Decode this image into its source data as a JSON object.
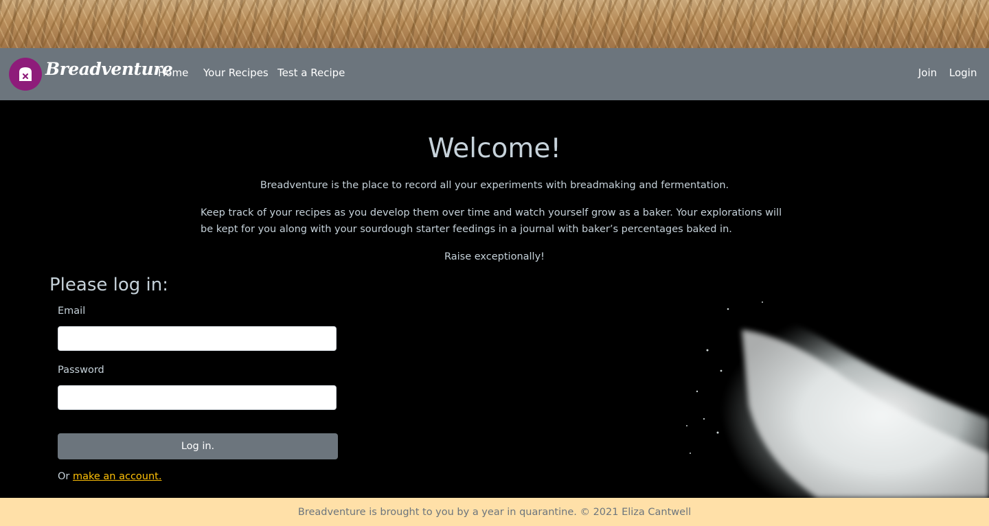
{
  "banner": {
    "image": "wheat-field-banner"
  },
  "nav": {
    "brand": "Breadventure",
    "logo_icon": "bread-loaf-icon",
    "links": [
      "Home",
      "Your Recipes",
      "Test a Recipe"
    ],
    "right_links": [
      "Join",
      "Login"
    ]
  },
  "hero": {
    "title": "Welcome!",
    "p1": "Breadventure is the place to record all your experiments with breadmaking and fermentation.",
    "p2_line1": "Keep track of your recipes as you develop them over time and watch yourself grow as a baker. Your explorations will",
    "p2_line2": "be kept for you along with your sourdough starter feedings in a journal with baker’s percentages baked in.",
    "p3": "Raise exceptionally!"
  },
  "login": {
    "title": "Please log in:",
    "email_label": "Email",
    "email_value": "",
    "password_label": "Password",
    "password_value": "",
    "submit_label": "Log in.",
    "or_prefix": "Or ",
    "signup_link": "make an account."
  },
  "footer": {
    "text": "Breadventure is brought to you by a year in quarantine. © 2021 Eliza Cantwell"
  },
  "colors": {
    "navbar": "#6c757d",
    "accent_link": "#ffc107",
    "footer_bg": "#ffe0a8",
    "logo_bg": "#8e1c7a"
  }
}
